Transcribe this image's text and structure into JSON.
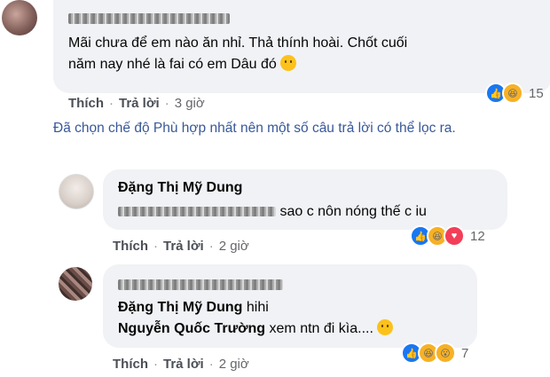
{
  "comment1": {
    "author": "Thu P**** Thuy",
    "text_line1": "Mãi chưa để em nào ăn nhỉ. Thả thính hoài. Chốt cuối",
    "text_line2": "năm nay nhé là fai có em Dâu đó",
    "like_label": "Thích",
    "reply_label": "Trả lời",
    "separator": "·",
    "time": "3 giờ",
    "reaction_count": "15",
    "reaction_icons": [
      "like-icon",
      "haha-icon"
    ]
  },
  "filter_notice": "Đã chọn chế độ Phù hợp nhất nên một số câu trả lời có thể lọc ra.",
  "reply1": {
    "author": "Đặng Thị Mỹ Dung",
    "text_suffix": "sao c nôn nóng thế c iu",
    "like_label": "Thích",
    "reply_label": "Trả lời",
    "separator": "·",
    "time": "2 giờ",
    "reaction_count": "12",
    "reaction_icons": [
      "like-icon",
      "haha-icon",
      "love-icon"
    ]
  },
  "reply2": {
    "author": "Pham Hoang Tuan",
    "mention1": "Đặng Thị Mỹ Dung",
    "mention1_text": "hihi",
    "mention2": "Nguyễn Quốc Trường",
    "mention2_text": "xem ntn đi kìa....",
    "like_label": "Thích",
    "reply_label": "Trả lời",
    "separator": "·",
    "time": "2 giờ",
    "reaction_count": "7",
    "reaction_icons": [
      "like-icon",
      "haha-icon",
      "wow-icon"
    ]
  },
  "colors": {
    "link_blue": "#385898",
    "bubble_bg": "#f0f2f5",
    "like_blue": "#1877f2",
    "haha_yellow": "#f7b125"
  }
}
